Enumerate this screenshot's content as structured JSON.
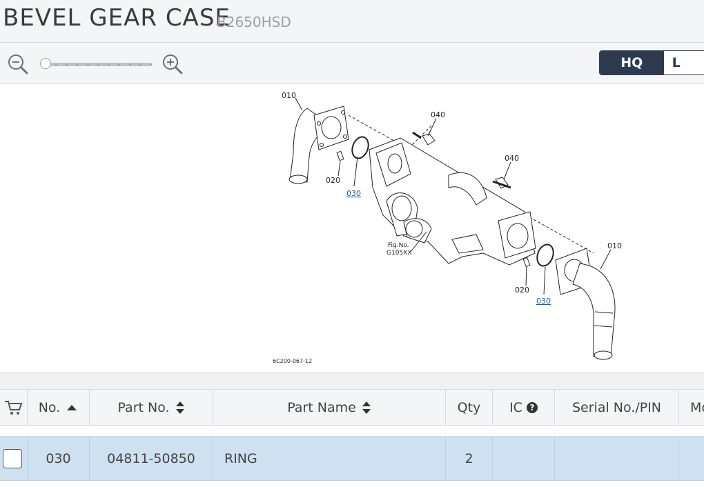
{
  "header": {
    "title": "BEVEL GEAR CASE",
    "model": "B2650HSD"
  },
  "toolbar": {
    "zoom_out_icon": "zoom-out-icon",
    "zoom_in_icon": "zoom-in-icon",
    "zoom_level": 0,
    "quality": {
      "options": [
        "HQ",
        "L"
      ],
      "selected": "HQ"
    }
  },
  "diagram": {
    "labels": {
      "l010a": "010",
      "l040a": "040",
      "l040b": "040",
      "l020a": "020",
      "l030a": "030",
      "l010b": "010",
      "l020b": "020",
      "l030b": "030",
      "fig": "Fig.No.",
      "fig_no": "G105XX",
      "ref": "6C200-067-12"
    }
  },
  "table": {
    "headers": {
      "cart_icon": "cart-icon",
      "no": "No.",
      "part_no": "Part No.",
      "part_name": "Part Name",
      "qty": "Qty",
      "ic": "IC",
      "serial": "Serial No./PIN",
      "more": "Mo"
    },
    "rows": [
      {
        "no": "030",
        "part_no": "04811-50850",
        "part_name": "RING",
        "qty": "2",
        "ic": "",
        "serial": ""
      }
    ]
  },
  "colors": {
    "accent": "#2d3a4f",
    "row_selected": "#cfe0f1",
    "highlight_label": "#1a5aa8"
  }
}
